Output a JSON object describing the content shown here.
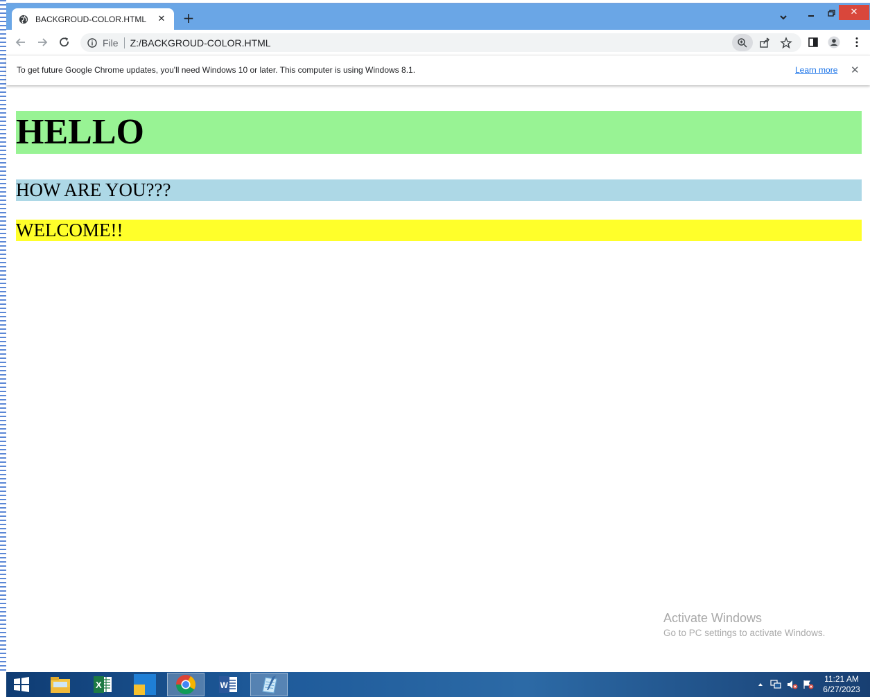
{
  "browser": {
    "tab_title": "BACKGROUD-COLOR.HTML",
    "url_scheme_label": "File",
    "url": "Z:/BACKGROUD-COLOR.HTML",
    "accent_tabbar": "#6aa6e6"
  },
  "infobar": {
    "message": "To get future Google Chrome updates, you'll need Windows 10 or later. This computer is using Windows 8.1.",
    "link": "Learn more"
  },
  "page": {
    "headings": [
      {
        "text": "HELLO",
        "background": "#98f394"
      },
      {
        "text": "HOW ARE YOU???",
        "background": "#add8e6"
      },
      {
        "text": "WELCOME!!",
        "background": "#ffff2a"
      }
    ]
  },
  "watermark": {
    "title": "Activate Windows",
    "subtitle": "Go to PC settings to activate Windows."
  },
  "taskbar": {
    "apps": [
      "start-icon",
      "file-explorer-icon",
      "excel-icon",
      "store-icon",
      "chrome-icon",
      "word-icon",
      "notepad-icon"
    ],
    "time": "11:21 AM",
    "date": "6/27/2023"
  }
}
